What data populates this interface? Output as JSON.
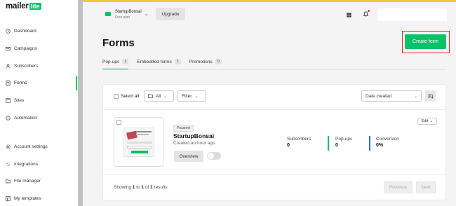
{
  "brand": {
    "name": "mailer",
    "badge": "lite",
    "accent": "#09c269"
  },
  "sidebar": {
    "items": [
      {
        "label": "Dashboard",
        "icon": "clock-icon"
      },
      {
        "label": "Campaigns",
        "icon": "mail-icon"
      },
      {
        "label": "Subscribers",
        "icon": "users-icon"
      },
      {
        "label": "Forms",
        "icon": "forms-icon",
        "active": true
      },
      {
        "label": "Sites",
        "icon": "sites-icon"
      },
      {
        "label": "Automation",
        "icon": "automation-icon"
      },
      {
        "label": "Account settings",
        "icon": "gear-icon"
      },
      {
        "label": "Integrations",
        "icon": "integrations-icon"
      },
      {
        "label": "File manager",
        "icon": "folder-icon"
      },
      {
        "label": "My templates",
        "icon": "templates-icon"
      }
    ]
  },
  "topbar": {
    "workspace_name": "StartupBonsai",
    "workspace_plan": "Free plan",
    "upgrade_label": "Upgrade"
  },
  "page": {
    "title": "Forms",
    "create_label": "Create form",
    "tabs": [
      {
        "label": "Pop-ups",
        "count": "1",
        "active": true
      },
      {
        "label": "Embedded forms",
        "count": "1"
      },
      {
        "label": "Promotions",
        "count": "0"
      }
    ]
  },
  "toolbar": {
    "select_all": "Select all",
    "all_label": "All",
    "filter_label": "Filter",
    "sort_label": "Date created"
  },
  "form_item": {
    "status": "Paused",
    "name": "StartupBonsai",
    "created": "Created an hour ago",
    "overview_label": "Overview",
    "edit_label": "Edit",
    "stats": [
      {
        "label": "Subscribers",
        "value": "0"
      },
      {
        "label": "Pop-ups",
        "value": "0"
      },
      {
        "label": "Conversion",
        "value": "0%"
      }
    ]
  },
  "pagination": {
    "showing_prefix": "Showing",
    "from": "1",
    "to_word": "to",
    "to": "1",
    "of_word": "of",
    "total": "1",
    "suffix": "results",
    "prev_label": "Previous",
    "next_label": "Next"
  }
}
